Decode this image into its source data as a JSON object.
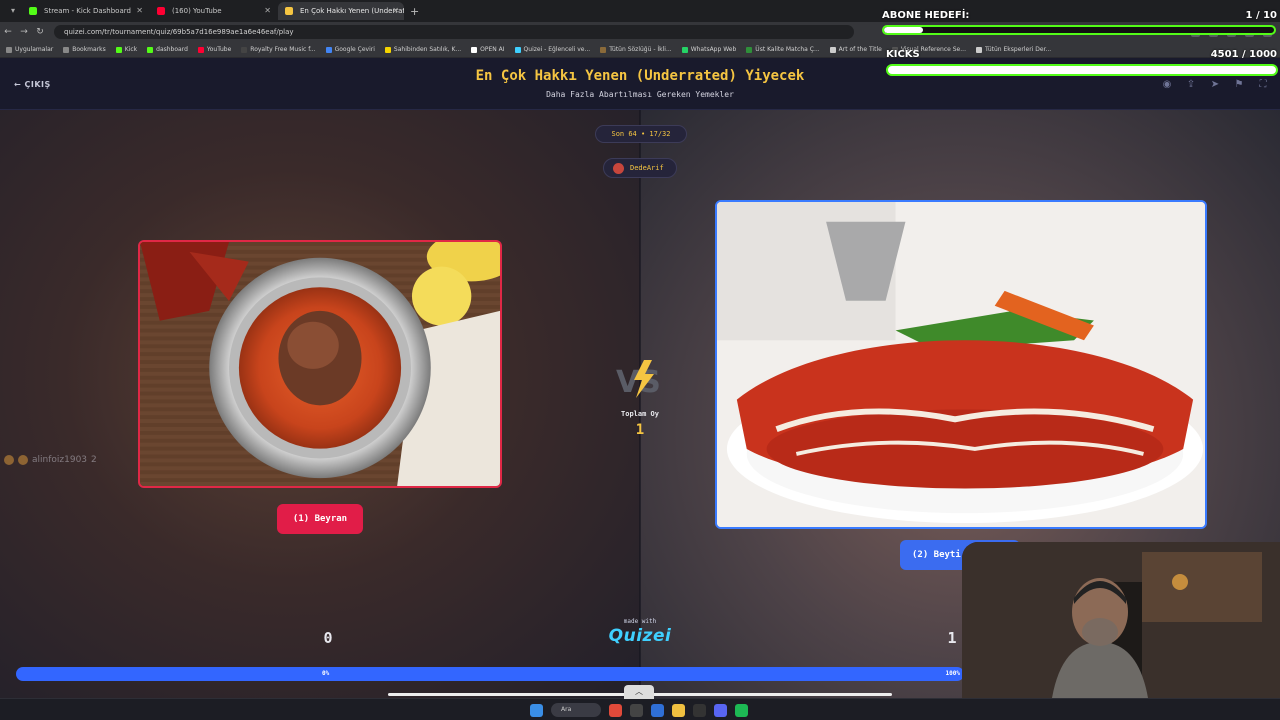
{
  "browser": {
    "tabs": [
      {
        "label": "Stream - Kick Dashboard",
        "favicon_color": "#53fc18"
      },
      {
        "label": "(160) YouTube",
        "favicon_color": "#ff0033"
      },
      {
        "label": "En Çok Hakkı Yenen (Underrate",
        "favicon_color": "#f5c542",
        "active": true
      }
    ],
    "url": "quizei.com/tr/tournament/quiz/69b5a7d16e989ae1a6e46eaf/play",
    "bookmarks": [
      {
        "label": "Uygulamalar",
        "color": "#888888"
      },
      {
        "label": "Bookmarks",
        "color": "#888888"
      },
      {
        "label": "Kick",
        "color": "#53fc18"
      },
      {
        "label": "dashboard",
        "color": "#53fc18"
      },
      {
        "label": "YouTube",
        "color": "#ff0033"
      },
      {
        "label": "Royalty Free Music f...",
        "color": "#444444"
      },
      {
        "label": "Google Çeviri",
        "color": "#4285f4"
      },
      {
        "label": "Sahibinden Satılık, K...",
        "color": "#f5d400"
      },
      {
        "label": "OPEN AI",
        "color": "#ffffff"
      },
      {
        "label": "Quizei - Eğlenceli ve...",
        "color": "#3fd0ff"
      },
      {
        "label": "Tütün Sözlüğü - İkli...",
        "color": "#8a6a3a"
      },
      {
        "label": "WhatsApp Web",
        "color": "#25d366"
      },
      {
        "label": "Üst Kalite Matcha Ç...",
        "color": "#2f8f3a"
      },
      {
        "label": "Art of the Title",
        "color": "#cccccc"
      },
      {
        "label": "Visual Reference Se...",
        "color": "#555555"
      },
      {
        "label": "Tütün Eksperleri Der...",
        "color": "#cccccc"
      }
    ]
  },
  "app": {
    "exit_label": "ÇIKIŞ",
    "title": "En Çok Hakkı Yenen (Underrated) Yiyecek",
    "subtitle": "Daha Fazla Abartılması Gereken Yemekler",
    "header_icons": [
      "eye-icon",
      "share-icon",
      "send-icon",
      "flag-icon",
      "fullscreen-icon"
    ]
  },
  "match": {
    "round": "Son 64 • 17/32",
    "user": "DedeArif",
    "total_votes_label": "Toplam Oy",
    "total_votes": "1",
    "left": {
      "label": "(1) Beyran",
      "score": "0",
      "percent_label": "0%"
    },
    "right": {
      "label": "(2) Beyti",
      "score": "1",
      "percent_label": "100%"
    },
    "left_fraction": 0.0,
    "voter_overlay": "alinfoiz1903",
    "voter_badge_count": "2"
  },
  "branding": {
    "made_with": "made with",
    "logo": "Quizei"
  },
  "stream_overlay": {
    "abone_title": "ABONE HEDEFİ:",
    "abone_count": "1 / 10",
    "abone_fraction": 0.1,
    "kicks_title": "KICKS",
    "kicks_count": "4501 / 1000",
    "kicks_fraction": 1.0
  },
  "taskbar": {
    "search_label": "Ara"
  },
  "colors": {
    "accent_yellow": "#f5c542",
    "left_red": "#e11d48",
    "right_blue": "#3b6cf0",
    "kick_green": "#53fc18"
  }
}
